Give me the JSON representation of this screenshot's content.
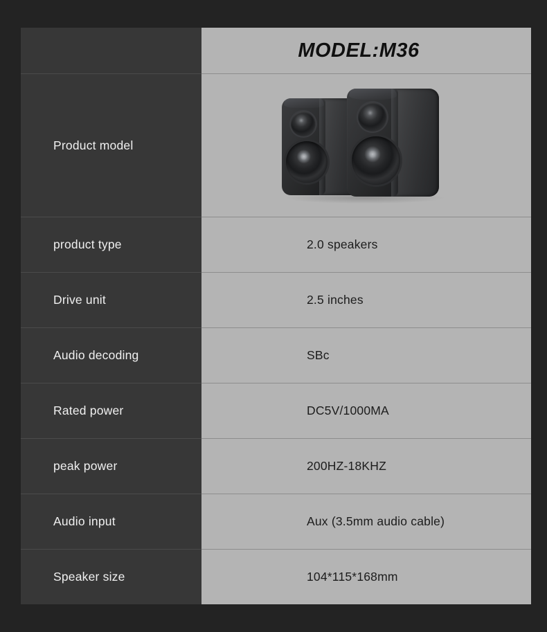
{
  "title": "MODEL:M36",
  "colors": {
    "page_background": "#232323",
    "label_column_background": "#373737",
    "value_column_background": "#b4b4b4",
    "label_text": "#f0f0f0",
    "value_text": "#1c1c1c",
    "title_text": "#101010",
    "divider_dark": "#4b4b4b",
    "divider_light": "#8d8d8d"
  },
  "rows": [
    {
      "label": "Product model",
      "value": "",
      "type": "image",
      "image_alt": "2.0 bookshelf speakers pair, black"
    },
    {
      "label": "product type",
      "value": "2.0 speakers",
      "type": "text"
    },
    {
      "label": "Drive unit",
      "value": "2.5 inches",
      "type": "text"
    },
    {
      "label": "Audio decoding",
      "value": "SBc",
      "type": "text"
    },
    {
      "label": "Rated power",
      "value": "DC5V/1000MA",
      "type": "text"
    },
    {
      "label": "peak power",
      "value": "200HZ-18KHZ",
      "type": "text"
    },
    {
      "label": "Audio input",
      "value": "Aux (3.5mm audio cable)",
      "type": "text"
    },
    {
      "label": "Speaker size",
      "value": "104*115*168mm",
      "type": "text"
    }
  ]
}
